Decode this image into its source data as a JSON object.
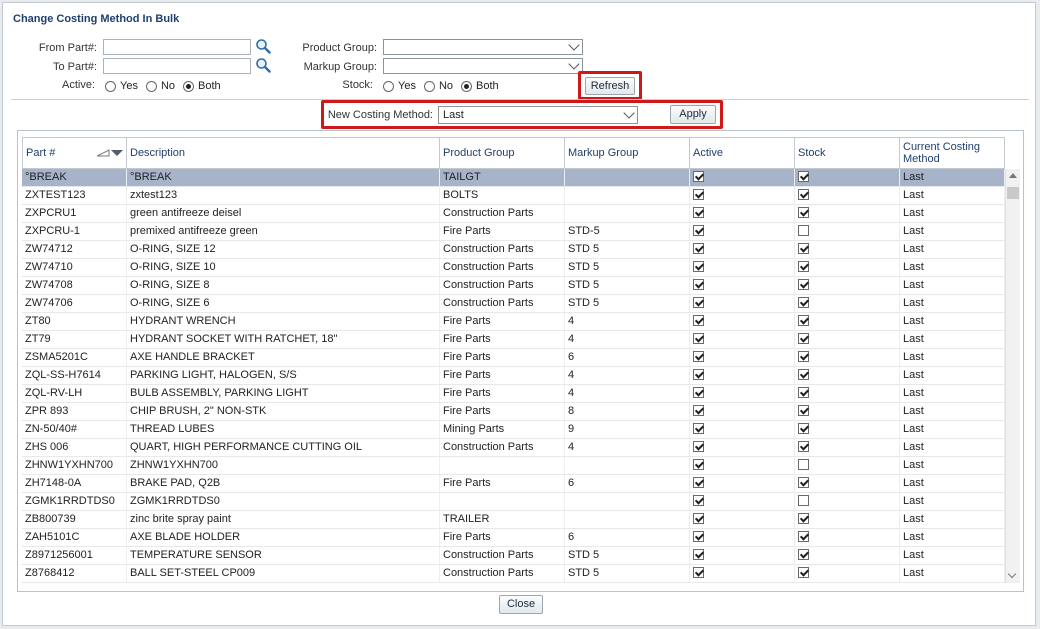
{
  "dialog": {
    "title": "Change Costing Method In Bulk"
  },
  "filters": {
    "from_part_label": "From Part#:",
    "to_part_label": "To Part#:",
    "from_part_value": "",
    "to_part_value": "",
    "active_label": "Active:",
    "product_group_label": "Product Group:",
    "markup_group_label": "Markup Group:",
    "stock_label": "Stock:",
    "product_group_value": "",
    "markup_group_value": "",
    "radio_yes": "Yes",
    "radio_no": "No",
    "radio_both": "Both",
    "active_selected": "Both",
    "stock_selected": "Both",
    "refresh_label": "Refresh"
  },
  "costing": {
    "label": "New Costing Method:",
    "value": "Last",
    "apply_label": "Apply"
  },
  "table": {
    "columns": [
      "Part #",
      "Description",
      "Product Group",
      "Markup Group",
      "Active",
      "Stock",
      "Current Costing Method"
    ],
    "rows": [
      {
        "part": "°BREAK",
        "desc": "°BREAK",
        "pg": "TAILGT",
        "mg": "",
        "active": true,
        "stock": true,
        "method": "Last",
        "selected": true
      },
      {
        "part": "ZXTEST123",
        "desc": "zxtest123",
        "pg": "BOLTS",
        "mg": "",
        "active": true,
        "stock": true,
        "method": "Last"
      },
      {
        "part": "ZXPCRU1",
        "desc": "green antifreeze deisel",
        "pg": "Construction Parts",
        "mg": "",
        "active": true,
        "stock": true,
        "method": "Last"
      },
      {
        "part": "ZXPCRU-1",
        "desc": "premixed antifreeze green",
        "pg": "Fire Parts",
        "mg": "STD-5",
        "active": true,
        "stock": false,
        "method": "Last"
      },
      {
        "part": "ZW74712",
        "desc": "O-RING, SIZE 12",
        "pg": "Construction Parts",
        "mg": "STD 5",
        "active": true,
        "stock": true,
        "method": "Last"
      },
      {
        "part": "ZW74710",
        "desc": "O-RING, SIZE 10",
        "pg": "Construction Parts",
        "mg": "STD 5",
        "active": true,
        "stock": true,
        "method": "Last"
      },
      {
        "part": "ZW74708",
        "desc": "O-RING, SIZE 8",
        "pg": "Construction Parts",
        "mg": "STD 5",
        "active": true,
        "stock": true,
        "method": "Last"
      },
      {
        "part": "ZW74706",
        "desc": "O-RING, SIZE 6",
        "pg": "Construction Parts",
        "mg": "STD 5",
        "active": true,
        "stock": true,
        "method": "Last"
      },
      {
        "part": "ZT80",
        "desc": "HYDRANT WRENCH",
        "pg": "Fire Parts",
        "mg": "4",
        "active": true,
        "stock": true,
        "method": "Last"
      },
      {
        "part": "ZT79",
        "desc": "HYDRANT SOCKET WITH RATCHET, 18\"",
        "pg": "Fire Parts",
        "mg": "4",
        "active": true,
        "stock": true,
        "method": "Last"
      },
      {
        "part": "ZSMA5201C",
        "desc": "AXE HANDLE BRACKET",
        "pg": "Fire Parts",
        "mg": "6",
        "active": true,
        "stock": true,
        "method": "Last"
      },
      {
        "part": "ZQL-SS-H7614",
        "desc": "PARKING LIGHT, HALOGEN, S/S",
        "pg": "Fire Parts",
        "mg": "4",
        "active": true,
        "stock": true,
        "method": "Last"
      },
      {
        "part": "ZQL-RV-LH",
        "desc": "BULB ASSEMBLY, PARKING LIGHT",
        "pg": "Fire Parts",
        "mg": "4",
        "active": true,
        "stock": true,
        "method": "Last"
      },
      {
        "part": "ZPR 893",
        "desc": "CHIP BRUSH, 2\" NON-STK",
        "pg": "Fire Parts",
        "mg": "8",
        "active": true,
        "stock": true,
        "method": "Last"
      },
      {
        "part": "ZN-50/40#",
        "desc": "THREAD LUBES",
        "pg": "Mining Parts",
        "mg": "9",
        "active": true,
        "stock": true,
        "method": "Last"
      },
      {
        "part": "ZHS 006",
        "desc": "QUART, HIGH PERFORMANCE CUTTING OIL",
        "pg": "Construction Parts",
        "mg": "4",
        "active": true,
        "stock": true,
        "method": "Last"
      },
      {
        "part": "ZHNW1YXHN700",
        "desc": "ZHNW1YXHN700",
        "pg": "",
        "mg": "",
        "active": true,
        "stock": false,
        "method": "Last"
      },
      {
        "part": "ZH7148-0A",
        "desc": "BRAKE PAD, Q2B",
        "pg": "Fire Parts",
        "mg": "6",
        "active": true,
        "stock": true,
        "method": "Last"
      },
      {
        "part": "ZGMK1RRDTDS0",
        "desc": "ZGMK1RRDTDS0",
        "pg": "",
        "mg": "",
        "active": true,
        "stock": false,
        "method": "Last"
      },
      {
        "part": "ZB800739",
        "desc": "zinc brite spray paint",
        "pg": "TRAILER",
        "mg": "",
        "active": true,
        "stock": true,
        "method": "Last"
      },
      {
        "part": "ZAH5101C",
        "desc": "AXE BLADE HOLDER",
        "pg": "Fire Parts",
        "mg": "6",
        "active": true,
        "stock": true,
        "method": "Last"
      },
      {
        "part": "Z8971256001",
        "desc": "TEMPERATURE SENSOR",
        "pg": "Construction Parts",
        "mg": "STD 5",
        "active": true,
        "stock": true,
        "method": "Last"
      },
      {
        "part": "Z8768412",
        "desc": "BALL SET-STEEL CP009",
        "pg": "Construction Parts",
        "mg": "STD 5",
        "active": true,
        "stock": true,
        "method": "Last"
      }
    ]
  },
  "footer": {
    "close_label": "Close"
  },
  "colors": {
    "highlight": "#d01818",
    "selected_row": "#a6b3c8",
    "title": "#1f3f6e"
  }
}
